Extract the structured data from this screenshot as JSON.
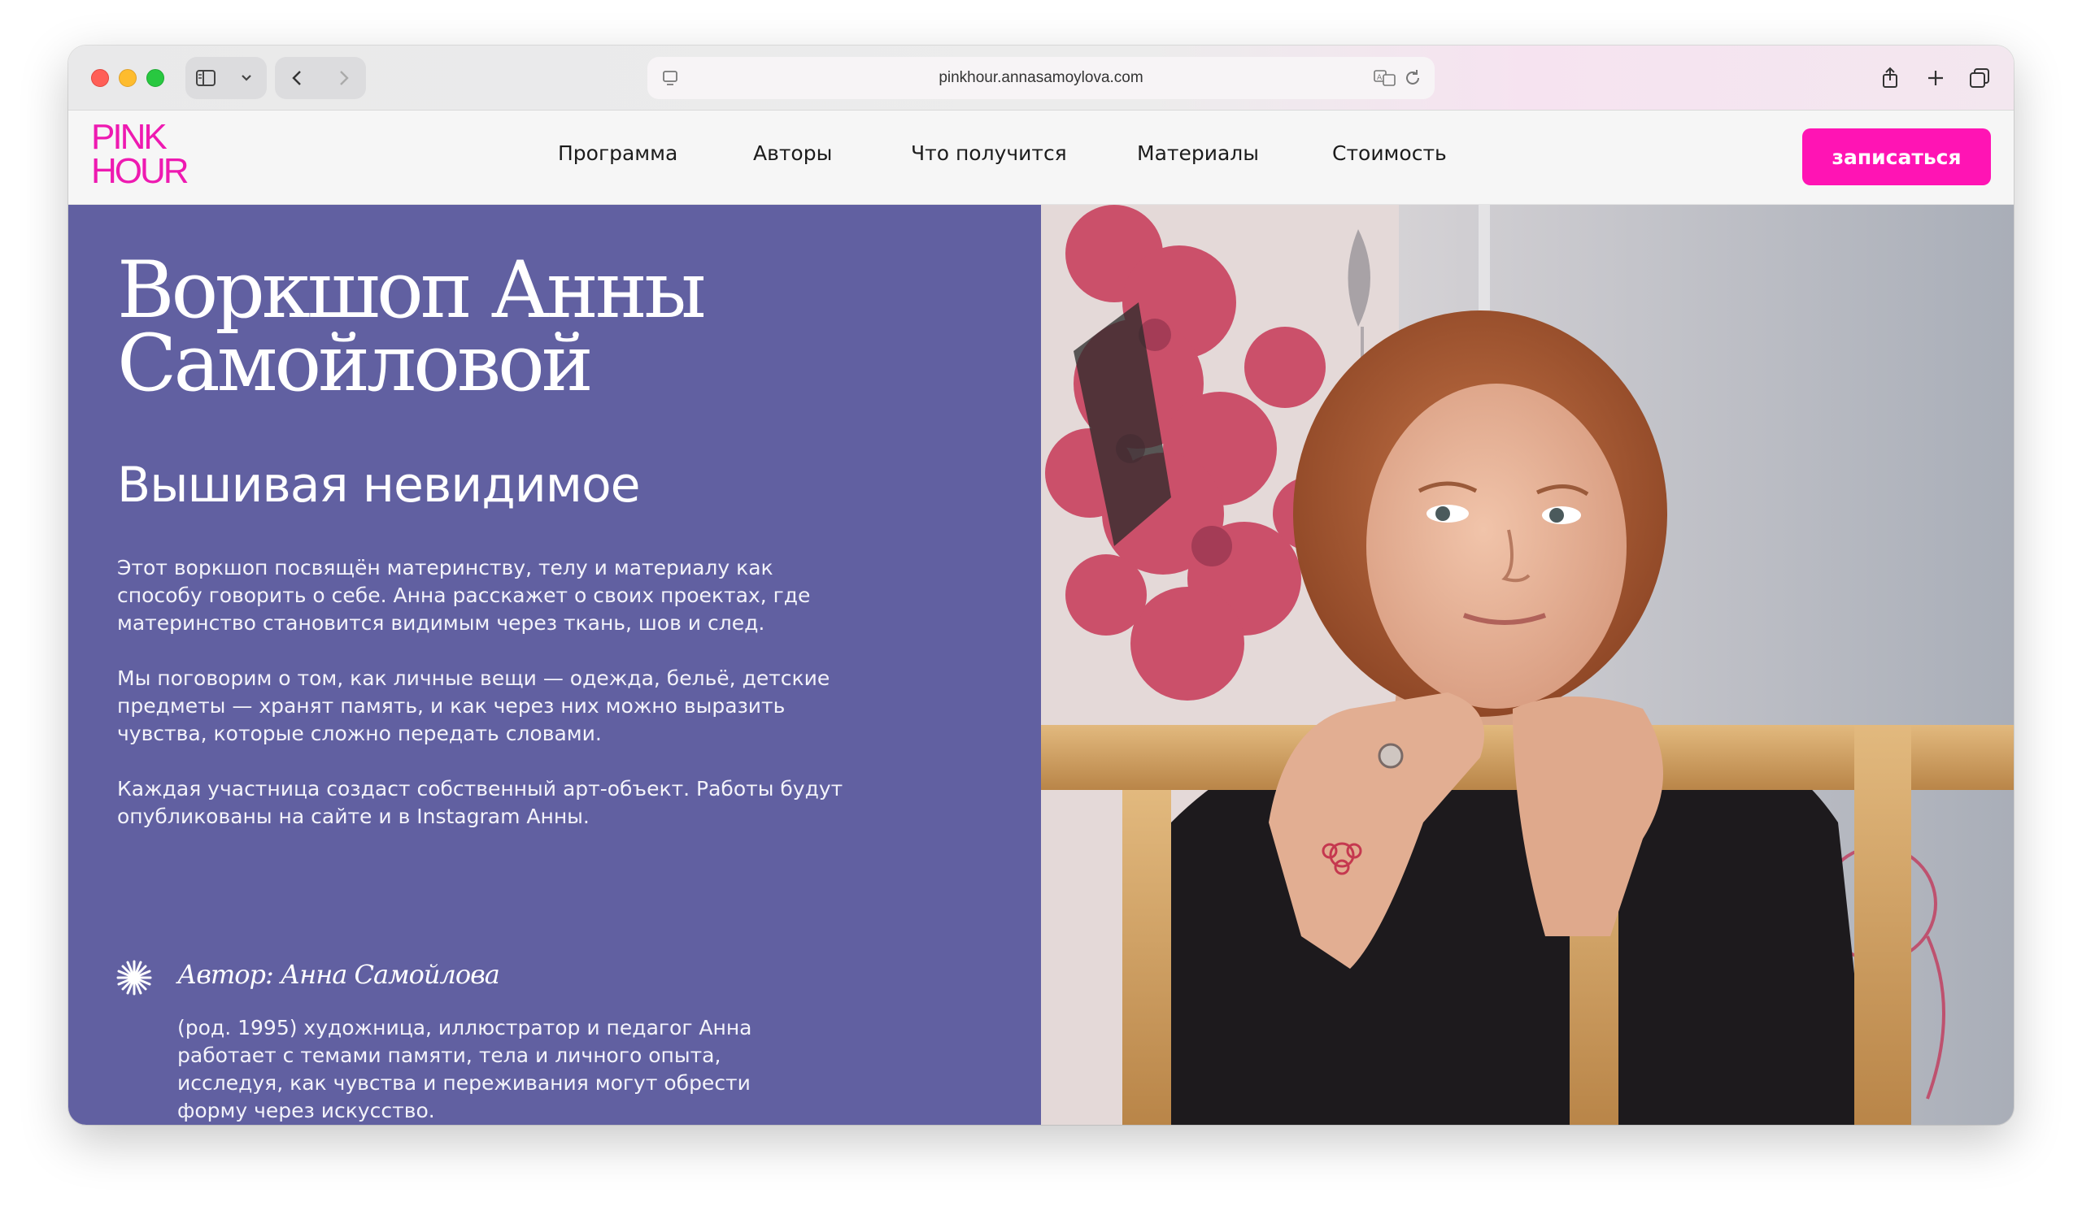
{
  "browser": {
    "url": "pinkhour.annasamoylova.com",
    "colors": {
      "close": "#ff5f57",
      "minimize": "#febc2e",
      "zoom": "#28c840"
    }
  },
  "site": {
    "logo_line1": "PINK",
    "logo_line2": "HOUR",
    "brand_color": "#ee1ab1",
    "nav": [
      {
        "label": "Программа"
      },
      {
        "label": "Авторы"
      },
      {
        "label": "Что получится"
      },
      {
        "label": "Материалы"
      },
      {
        "label": "Стоимость"
      }
    ],
    "cta_label": "записаться",
    "cta_color": "#ff14b4"
  },
  "hero": {
    "background": "#6160a1",
    "title_line1": "Воркшоп Анны",
    "title_line2": "Самойловой",
    "subtitle": "Вышивая невидимое",
    "paragraphs": [
      "Этот воркшоп посвящён материнству, телу и материалу как способу говорить о себе. Анна расскажет о своих проектах, где материнство становится видимым через ткань, шов и след.",
      "Мы поговорим о том, как личные вещи — одежда, бельё, детские предметы — хранят память, и как через них можно выразить чувства, которые сложно передать словами.",
      "Каждая участница создаст собственный арт-объект. Работы будут опубликованы на сайте и в Instagram Анны."
    ],
    "author_label": "Автор: Анна Самойлова",
    "author_bio": "(род. 1995) художница, иллюстратор и педагог Анна работает с темами памяти, тела и личного опыта, исследуя, как чувства и переживания могут обрести форму через искусство.",
    "author_icon": "asterisk-star-icon"
  }
}
